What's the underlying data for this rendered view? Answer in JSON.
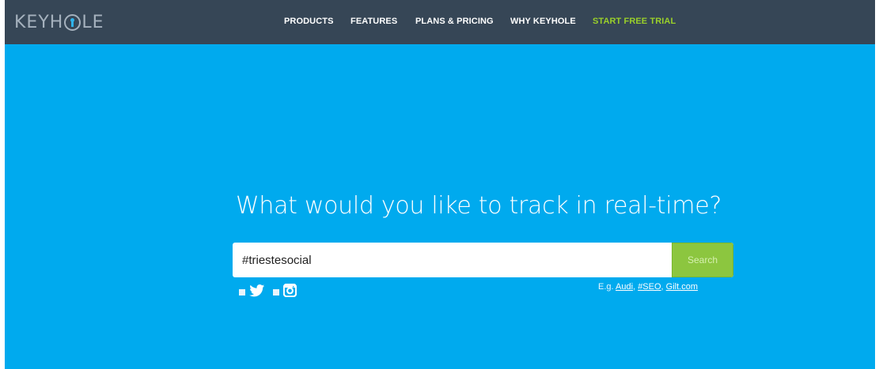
{
  "brand": {
    "logo_left": "KEYH",
    "logo_right": "LE"
  },
  "nav": {
    "products": "PRODUCTS",
    "features": "FEATURES",
    "plans": "PLANS & PRICING",
    "why": "WHY KEYHOLE",
    "trial": "START FREE TRIAL"
  },
  "hero": {
    "headline": "What would you like to track in real-time?",
    "search_value": "#triestesocial",
    "search_button": "Search",
    "examples_prefix": "E.g.",
    "example_links": [
      "Audi",
      "#SEO",
      "Gilt.com"
    ]
  },
  "sources": [
    {
      "name": "twitter",
      "icon": "twitter-icon"
    },
    {
      "name": "instagram",
      "icon": "instagram-icon"
    }
  ],
  "colors": {
    "navbar": "#364656",
    "hero": "#00aaee",
    "accent_green": "#8cc63f",
    "trial_green": "#9ad02a"
  }
}
